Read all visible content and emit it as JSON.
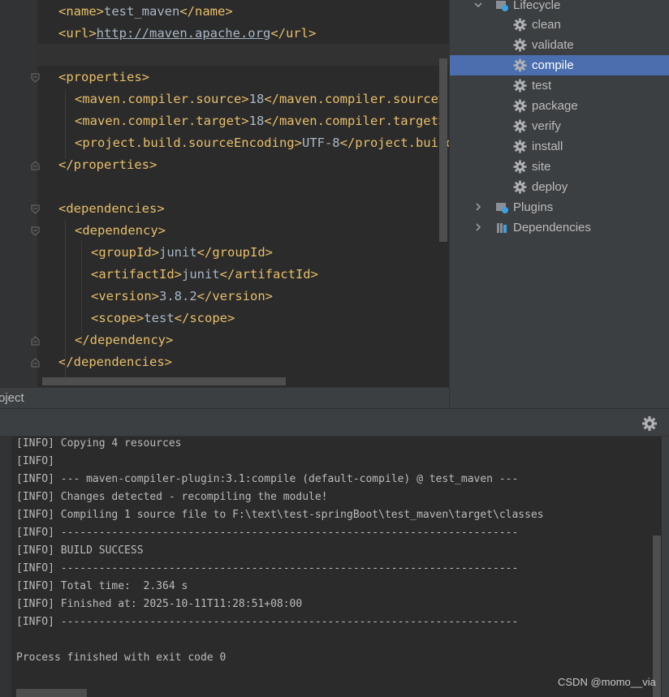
{
  "editor": {
    "lines": [
      {
        "indent": 0,
        "parts": [
          {
            "k": "tag",
            "t": "<name>"
          },
          {
            "k": "txt",
            "t": "test_maven"
          },
          {
            "k": "tag",
            "t": "</name>"
          }
        ]
      },
      {
        "indent": 0,
        "parts": [
          {
            "k": "tag",
            "t": "<url>"
          },
          {
            "k": "url",
            "t": "http://maven.apache.org"
          },
          {
            "k": "tag",
            "t": "</url>"
          }
        ]
      },
      {
        "indent": 0,
        "parts": []
      },
      {
        "indent": 0,
        "parts": [
          {
            "k": "tag",
            "t": "<properties>"
          }
        ]
      },
      {
        "indent": 1,
        "parts": [
          {
            "k": "tag",
            "t": "<maven.compiler.source>"
          },
          {
            "k": "txt",
            "t": "18"
          },
          {
            "k": "tag",
            "t": "</maven.compiler.source>"
          }
        ]
      },
      {
        "indent": 1,
        "parts": [
          {
            "k": "tag",
            "t": "<maven.compiler.target>"
          },
          {
            "k": "txt",
            "t": "18"
          },
          {
            "k": "tag",
            "t": "</maven.compiler.target>"
          }
        ]
      },
      {
        "indent": 1,
        "parts": [
          {
            "k": "tag",
            "t": "<project.build.sourceEncoding>"
          },
          {
            "k": "txt",
            "t": "UTF-8"
          },
          {
            "k": "tag",
            "t": "</project.build.sourceEncoding>"
          }
        ]
      },
      {
        "indent": 0,
        "parts": [
          {
            "k": "tag",
            "t": "</properties>"
          }
        ]
      },
      {
        "indent": 0,
        "parts": []
      },
      {
        "indent": 0,
        "parts": [
          {
            "k": "tag",
            "t": "<dependencies>"
          }
        ]
      },
      {
        "indent": 1,
        "parts": [
          {
            "k": "tag",
            "t": "<dependency>"
          }
        ]
      },
      {
        "indent": 2,
        "parts": [
          {
            "k": "tag",
            "t": "<groupId>"
          },
          {
            "k": "txt",
            "t": "junit"
          },
          {
            "k": "tag",
            "t": "</groupId>"
          }
        ]
      },
      {
        "indent": 2,
        "parts": [
          {
            "k": "tag",
            "t": "<artifactId>"
          },
          {
            "k": "txt",
            "t": "junit"
          },
          {
            "k": "tag",
            "t": "</artifactId>"
          }
        ]
      },
      {
        "indent": 2,
        "parts": [
          {
            "k": "tag",
            "t": "<version>"
          },
          {
            "k": "txt",
            "t": "3.8.2"
          },
          {
            "k": "tag",
            "t": "</version>"
          }
        ]
      },
      {
        "indent": 2,
        "parts": [
          {
            "k": "tag",
            "t": "<scope>"
          },
          {
            "k": "txt",
            "t": "test"
          },
          {
            "k": "tag",
            "t": "</scope>"
          }
        ]
      },
      {
        "indent": 1,
        "parts": [
          {
            "k": "tag",
            "t": "</dependency>"
          }
        ]
      },
      {
        "indent": 0,
        "parts": [
          {
            "k": "tag",
            "t": "</dependencies>"
          }
        ]
      }
    ]
  },
  "maven_tree": {
    "lifecycle_label": "Lifecycle",
    "phases": [
      "clean",
      "validate",
      "compile",
      "test",
      "package",
      "verify",
      "install",
      "site",
      "deploy"
    ],
    "selected_phase": "compile",
    "plugins_label": "Plugins",
    "dependencies_label": "Dependencies"
  },
  "project_bar": {
    "label": "oject"
  },
  "console": {
    "lines": [
      "[INFO] Copying 4 resources",
      "[INFO]",
      "[INFO] --- maven-compiler-plugin:3.1:compile (default-compile) @ test_maven ---",
      "[INFO] Changes detected - recompiling the module!",
      "[INFO] Compiling 1 source file to F:\\text\\test-springBoot\\test_maven\\target\\classes",
      "[INFO] ------------------------------------------------------------------------",
      "[INFO] BUILD SUCCESS",
      "[INFO] ------------------------------------------------------------------------",
      "[INFO] Total time:  2.364 s",
      "[INFO] Finished at: 2025-10-11T11:28:51+08:00",
      "[INFO] ------------------------------------------------------------------------",
      "",
      "Process finished with exit code 0"
    ]
  },
  "watermark": "CSDN @momo__via",
  "colors": {
    "selection": "#4b6eaf",
    "tag": "#e8bf6a",
    "text": "#a9b7c6",
    "panel": "#3c3f41",
    "editor_bg": "#2b2b2b"
  }
}
